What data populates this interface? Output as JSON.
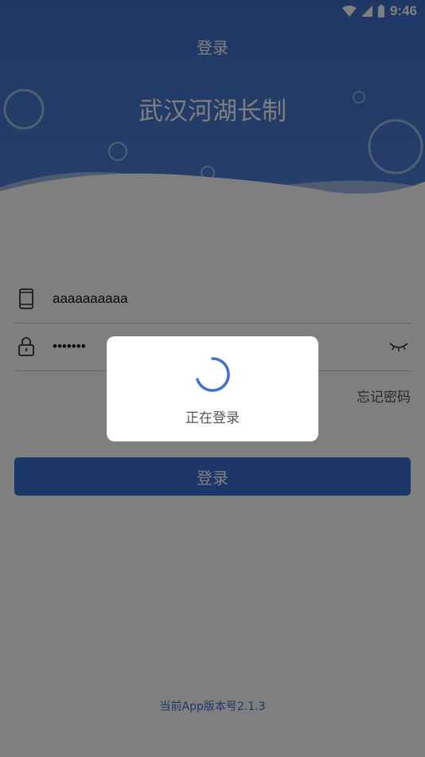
{
  "status_bar": {
    "time": "9:46"
  },
  "header": {
    "title": "登录",
    "app_name": "武汉河湖长制"
  },
  "form": {
    "phone": {
      "icon": "phone-icon",
      "value": "aaaaaaaaaa"
    },
    "password": {
      "icon": "lock-icon",
      "value": "•••••••",
      "toggle_icon": "eye-closed-icon"
    },
    "forgot_label": "忘记密码",
    "login_label": "登录"
  },
  "footer": {
    "version_text": "当前App版本号2.1.3"
  },
  "dialog": {
    "message": "正在登录"
  },
  "colors": {
    "header": "#3f6fc9",
    "accent": "#3d6fd6",
    "overlay": "rgba(0,0,0,0.5)"
  }
}
